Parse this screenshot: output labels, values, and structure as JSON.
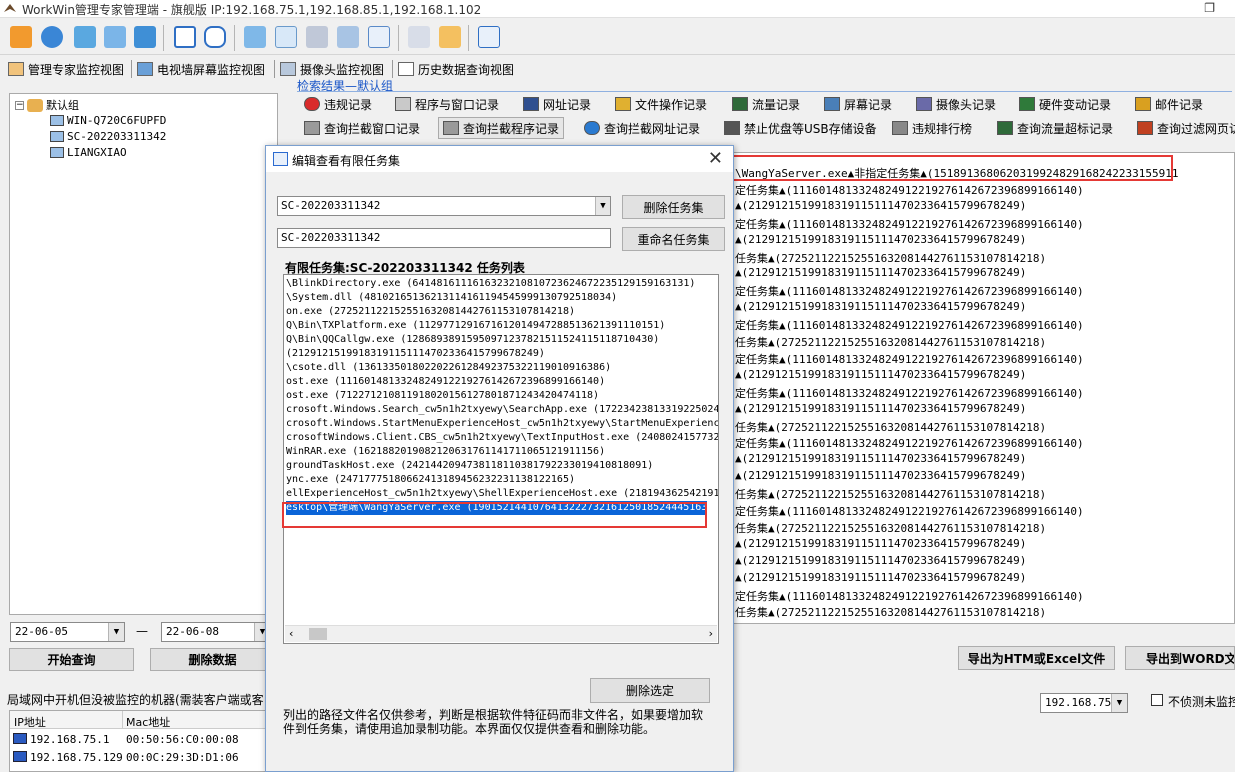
{
  "app": {
    "title": "WorkWin管理专家管理端 - 旗舰版 IP:192.168.75.1,192.168.85.1,192.168.1.102"
  },
  "view_tabs": [
    {
      "label": "管理专家监控视图"
    },
    {
      "label": "电视墙屏幕监控视图"
    },
    {
      "label": "摄像头监控视图"
    },
    {
      "label": "历史数据查询视图"
    }
  ],
  "tree": {
    "group": "默认组",
    "computers": [
      "WIN-Q720C6FUPFD",
      "SC-202203311342",
      "LIANGXIAO"
    ]
  },
  "left_controls": {
    "date_from": "22-06-05",
    "date_sep": "—",
    "date_to": "22-06-08",
    "query_button": "开始查询",
    "delete_button": "删除数据"
  },
  "right": {
    "title": "检索结果—默认组",
    "tabs_row1": [
      {
        "label": "违规记录",
        "color": "#d92b2b"
      },
      {
        "label": "程序与窗口记录",
        "color": "#c9c9c9"
      },
      {
        "label": "网址记录",
        "color": "#2f4f8f"
      },
      {
        "label": "文件操作记录",
        "color": "#e0b030"
      },
      {
        "label": "流量记录",
        "color": "#2f6a3a"
      },
      {
        "label": "屏幕记录",
        "color": "#4a7fb8"
      },
      {
        "label": "摄像头记录",
        "color": "#6a6aa8"
      },
      {
        "label": "硬件变动记录",
        "color": "#2f7a3a"
      },
      {
        "label": "邮件记录",
        "color": "#d9a020"
      }
    ],
    "tabs_row2": [
      {
        "label": "查询拦截窗口记录",
        "color": "#9a9a9a"
      },
      {
        "label": "查询拦截程序记录",
        "color": "#9a9a9a"
      },
      {
        "label": "查询拦截网址记录",
        "color": "#2a7ad0"
      },
      {
        "label": "禁止优盘等USB存储设备",
        "color": "#555555"
      },
      {
        "label": "违规排行榜",
        "color": "#888888"
      },
      {
        "label": "查询流量超标记录",
        "color": "#2f6a3a"
      },
      {
        "label": "查询过滤网页访",
        "color": "#c04020"
      }
    ],
    "results": [
      "\\WangYaServer.exe▲非指定任务集▲(151891368062031992482916824223315591​1",
      "定任务集▲(111601481332482491221927614267239689916614​0)",
      "▲(2129121519918319115111470233641579967824​9)",
      "定任务集▲(111601481332482491221927614267239689916614​0)",
      "▲(2129121519918319115111470233641579967824​9)",
      "任务集▲(2725211221525516320814427611531078142​18)",
      "▲(2129121519918319115111470233641579967824​9)",
      "定任务集▲(111601481332482491221927614267239689916614​0)",
      "▲(2129121519918319115111470233641579967824​9)",
      "定任务集▲(111601481332482491221927614267239689916614​0)",
      "任务集▲(2725211221525516320814427611531078142​18)",
      "定任务集▲(111601481332482491221927614267239689916614​0)",
      "▲(2129121519918319115111470233641579967824​9)",
      "定任务集▲(111601481332482491221927614267239689916614​0)",
      "▲(2129121519918319115111470233641579967824​9)",
      "任务集▲(2725211221525516320814427611531078142​18)",
      "定任务集▲(111601481332482491221927614267239689916614​0)",
      "▲(2129121519918319115111470233641579967824​9)",
      "▲(2129121519918319115111470233641579967824​9)",
      "任务集▲(2725211221525516320814427611531078142​18)",
      "定任务集▲(111601481332482491221927614267239689916614​0)",
      "任务集▲(2725211221525516320814427611531078142​18)",
      "▲(2129121519918319115111470233641579967824​9)",
      "▲(2129121519918319115111470233641579967824​9)",
      "▲(2129121519918319115111470233641579967824​9)",
      "定任务集▲(111601481332482491221927614267239689916614​0)",
      "任务集▲(2725211221525516320814427611531078142​18)"
    ],
    "export_html": "导出为HTM或Excel文件",
    "export_word": "导出到WORD文件"
  },
  "bottom": {
    "label": "局域网中开机但没被监控的机器(需装客户端或客",
    "ip_select": "192.168.75",
    "checkbox_label": "不侦测未监控",
    "columns": [
      "IP地址",
      "Mac地址"
    ],
    "rows": [
      {
        "ip": "192.168.75.1",
        "mac": "00:50:56:C0:00:08"
      },
      {
        "ip": "192.168.75.129",
        "mac": "00:0C:29:3D:D1:06"
      }
    ]
  },
  "dialog": {
    "title": "编辑查看有限任务集",
    "task_set_select": "SC-202203311342",
    "rename_field": "SC-202203311342",
    "delete_set_button": "删除任务集",
    "rename_set_button": "重命名任务集",
    "list_header": "有限任务集:SC-202203311342 任务列表",
    "tasks": [
      "\\BlinkDirectory.exe (641481611161632321081072362467223512915916313​1)",
      "\\System.dll (4810216513621311416119454599913079251803​4)",
      "on.exe (2725211221525516320814427611531078142​18)",
      "Q\\Bin\\TXPlatform.exe (112977129167161201494728851362139111015​1)",
      "Q\\Bin\\QQCallgw.exe (128689389159509712378215115241151187104​30)",
      "(2129121519918319115111470233641579967824​9)",
      "\\csote.dll (1361335018022022612849237532211901091638​6)",
      "ost.exe (111601481332482491221927614267239689916614​0)",
      "ost.exe (7122712108119180201561278018712434204741​18)",
      "crosoft.Windows.Search_cw5n1h2txyewy\\SearchApp.exe (17223423813319225024",
      "crosoft.Windows.StartMenuExperienceHost_cw5n1h2txyewy\\StartMenuExperienc",
      "crosoftWindows.Client.CBS_cw5n1h2txyewy\\TextInputHost.exe (2408024157732",
      "WinRAR.exe (16218820190821206317611417110651219111​56)",
      "groundTaskHost.exe (2421442094738118110381792233019410818091)",
      "ync.exe (24717775180662413189456232231138122165)",
      "ellExperienceHost_cw5n1h2txyewy\\ShellExperienceHost.exe (218194362542191",
      "esktop\\管理端\\WangYaServer.exe (1901521441076413222732161250185244451​63"
    ],
    "delete_selected_button": "删除选定",
    "note": "列出的路径文件名仅供参考，判断是根据软件特征码而非文件名，如果要增加软件到任务集，请使用追加录制功能。本界面仅仅提供查看和删除功能。"
  },
  "colors": {
    "highlight": "#e53935",
    "selection": "#0a64d8",
    "title_link": "#1a56c8"
  }
}
